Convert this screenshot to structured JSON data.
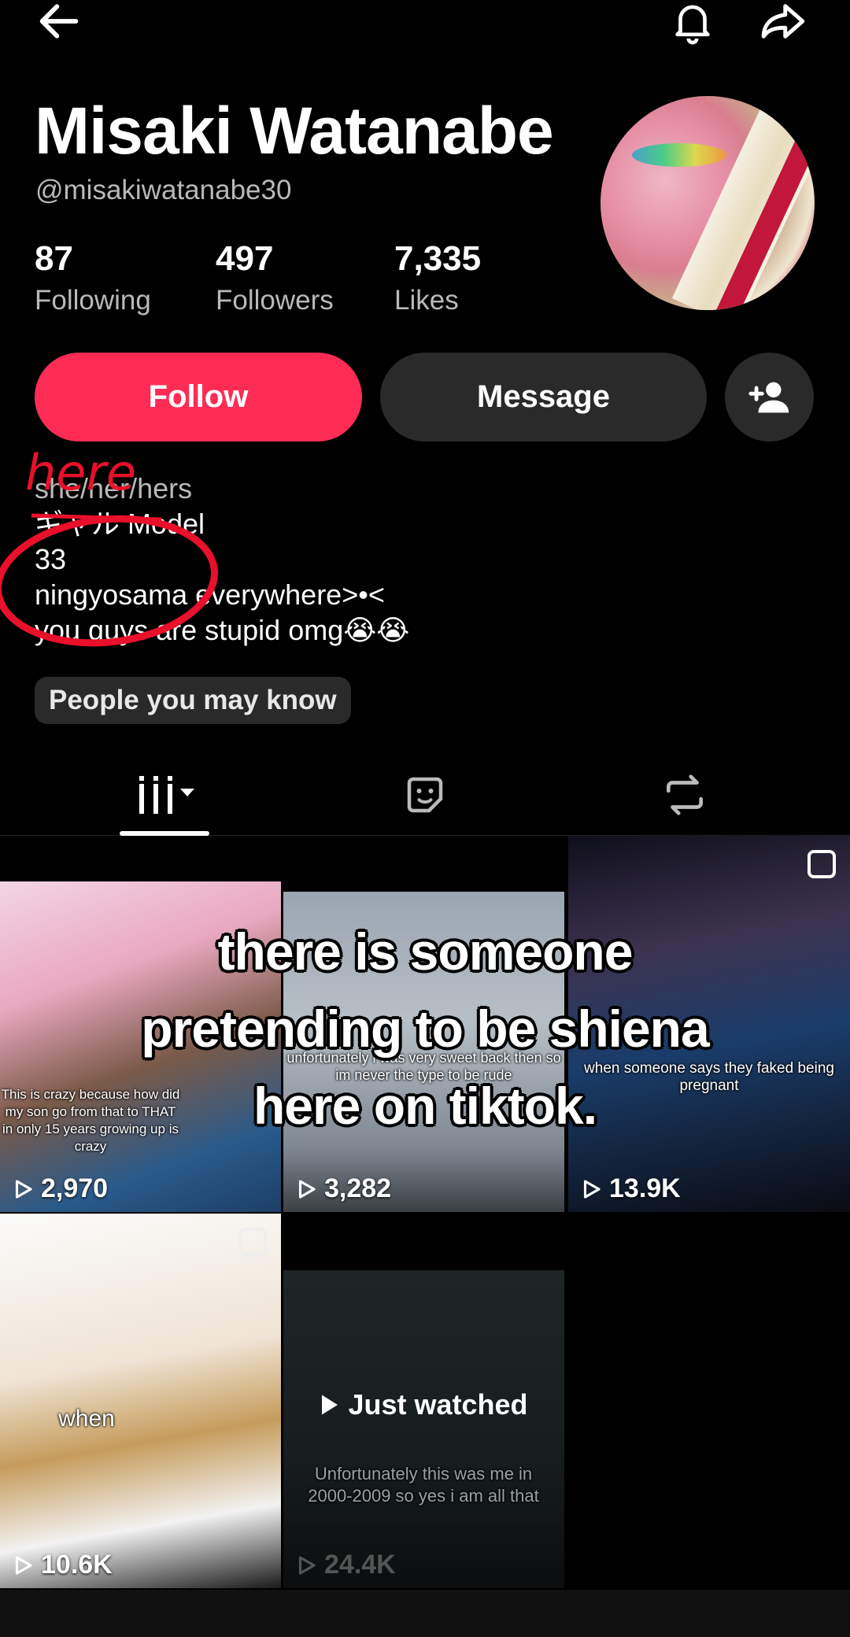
{
  "profile": {
    "name": "Misaki Watanabe",
    "handle": "@misakiwatanabe30",
    "stats": {
      "following_count": "87",
      "following_label": "Following",
      "followers_count": "497",
      "followers_label": "Followers",
      "likes_count": "7,335",
      "likes_label": "Likes"
    },
    "buttons": {
      "follow": "Follow",
      "message": "Message"
    },
    "bio": {
      "pronouns": "she/her/hers",
      "line2": "ギャル Model",
      "line3": "33",
      "line4": "ningyosama  everywhere>•<",
      "line5": "you guys are stupid omg😭😭"
    },
    "annotation": "here",
    "people_you_may_know": "People you may know"
  },
  "tabs": [
    "videos-tab",
    "liked-tab",
    "reposts-tab"
  ],
  "videos": [
    {
      "views": "2,970",
      "caption": "This is crazy because how did my son go from that to THAT in only 15 years growing up is crazy"
    },
    {
      "views": "3,282",
      "caption": "unfortunately i was very sweet back then so im never the type to be rude"
    },
    {
      "views": "13.9K",
      "caption": "when someone says they faked being pregnant"
    },
    {
      "views": "10.6K",
      "caption": "when"
    },
    {
      "views": "24.4K",
      "caption": "Unfortunately this was me in 2000-2009 so yes i am all that",
      "badge": "Just watched"
    }
  ],
  "overlay_text": "there is someone pretending to be shiena here on tiktok.",
  "colors": {
    "accent": "#fe2c55",
    "background": "#000000",
    "secondary_button": "#2a2a2a",
    "annotation": "#e8102a"
  }
}
